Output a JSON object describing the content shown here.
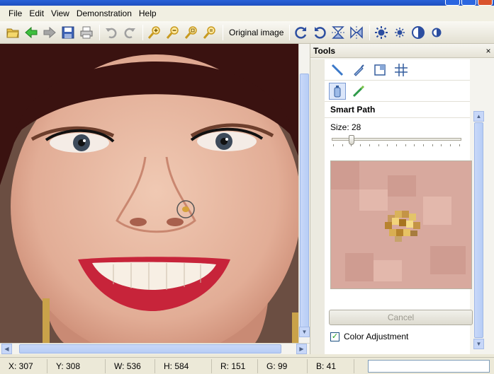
{
  "menu": {
    "items": [
      {
        "label": "File"
      },
      {
        "label": "Edit"
      },
      {
        "label": "View"
      },
      {
        "label": "Demonstration"
      },
      {
        "label": "Help"
      }
    ]
  },
  "toolbar": {
    "original_image_label": "Original image",
    "icons": [
      "open-folder-icon",
      "back-arrow-icon",
      "forward-arrow-icon",
      "save-icon",
      "print-icon",
      "undo-icon",
      "redo-icon",
      "zoom-in-icon",
      "zoom-out-icon",
      "zoom-fit-icon",
      "zoom-actual-icon",
      "rotate-cw-icon",
      "rotate-ccw-icon",
      "flip-vertical-icon",
      "flip-horizontal-icon",
      "brightness-up-icon",
      "brightness-down-icon",
      "contrast-up-icon",
      "contrast-down-icon"
    ]
  },
  "tools_panel": {
    "title": "Tools",
    "close_label": "×",
    "section_title": "Smart Path",
    "size_label": "Size: 28",
    "size_value": 28,
    "cancel_label": "Cancel",
    "color_adjustment_label": "Color Adjustment",
    "color_adjustment_checked": true
  },
  "status": {
    "x": "X: 307",
    "y": "Y: 308",
    "w": "W: 536",
    "h": "H: 584",
    "r": "R: 151",
    "g": "G: 99",
    "b": "B: 41"
  }
}
